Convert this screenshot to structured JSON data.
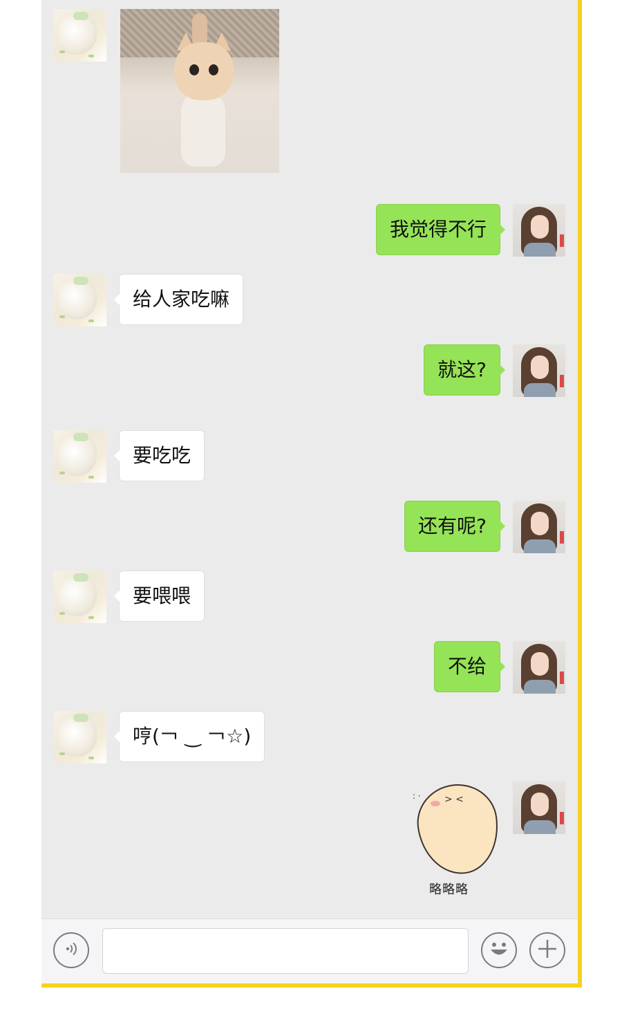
{
  "chat": {
    "messages": [
      {
        "sender": "other",
        "type": "image",
        "description": "cat-photo"
      },
      {
        "sender": "self",
        "type": "text",
        "text": "我觉得不行"
      },
      {
        "sender": "other",
        "type": "text",
        "text": "给人家吃嘛"
      },
      {
        "sender": "self",
        "type": "text",
        "text": "就这?"
      },
      {
        "sender": "other",
        "type": "text",
        "text": "要吃吃"
      },
      {
        "sender": "self",
        "type": "text",
        "text": "还有呢?"
      },
      {
        "sender": "other",
        "type": "text",
        "text": "要喂喂"
      },
      {
        "sender": "self",
        "type": "text",
        "text": "不给"
      },
      {
        "sender": "other",
        "type": "text",
        "text": "哼(￢ ‿ ￢☆)"
      },
      {
        "sender": "self",
        "type": "sticker",
        "caption": "略略略"
      }
    ]
  },
  "input_bar": {
    "voice_icon": "voice-icon",
    "emoji_icon": "emoji-icon",
    "plus_icon": "plus-icon",
    "input_value": ""
  },
  "colors": {
    "chat_background": "#ebebeb",
    "self_bubble": "#95e356",
    "other_bubble": "#ffffff",
    "frame_accent": "#f5d31c"
  }
}
